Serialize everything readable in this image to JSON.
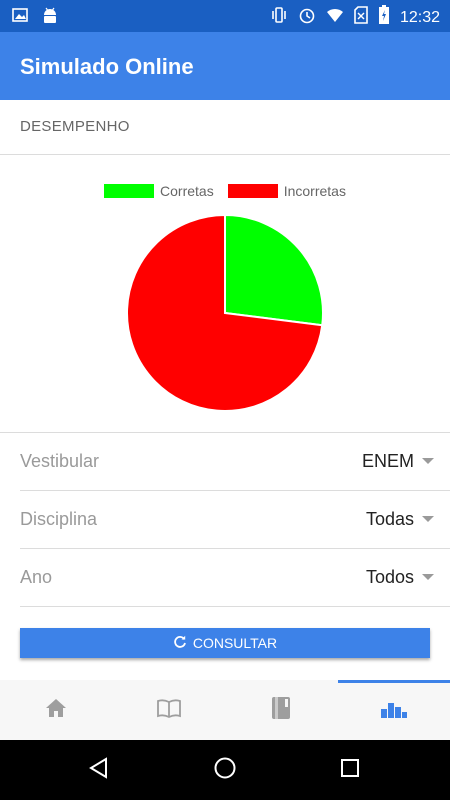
{
  "status_bar": {
    "time": "12:32",
    "left_icons": [
      "image-icon",
      "android-icon"
    ],
    "right_icons": [
      "vibrate-icon",
      "alarm-icon",
      "wifi-icon",
      "no-sim-icon",
      "battery-icon"
    ]
  },
  "app_bar": {
    "title": "Simulado Online",
    "color": "#3d82e8"
  },
  "section": {
    "title": "DESEMPENHO"
  },
  "chart_data": {
    "type": "pie",
    "legend": [
      "Corretas",
      "Incorretas"
    ],
    "labels": [
      "Corretas",
      "Incorretas"
    ],
    "values": [
      27,
      73
    ],
    "colors": [
      "#00ff00",
      "#ff0000"
    ],
    "legend_position": "top"
  },
  "filters": [
    {
      "label": "Vestibular",
      "value": "ENEM"
    },
    {
      "label": "Disciplina",
      "value": "Todas"
    },
    {
      "label": "Ano",
      "value": "Todos"
    }
  ],
  "consult_button": {
    "label": "CONSULTAR",
    "icon": "refresh-icon"
  },
  "bottom_nav": {
    "items": [
      "home-icon",
      "book-open-icon",
      "book-icon",
      "bar-chart-icon"
    ],
    "active_index": 3
  },
  "system_nav": [
    "back-icon",
    "home-circle-icon",
    "recents-icon"
  ]
}
